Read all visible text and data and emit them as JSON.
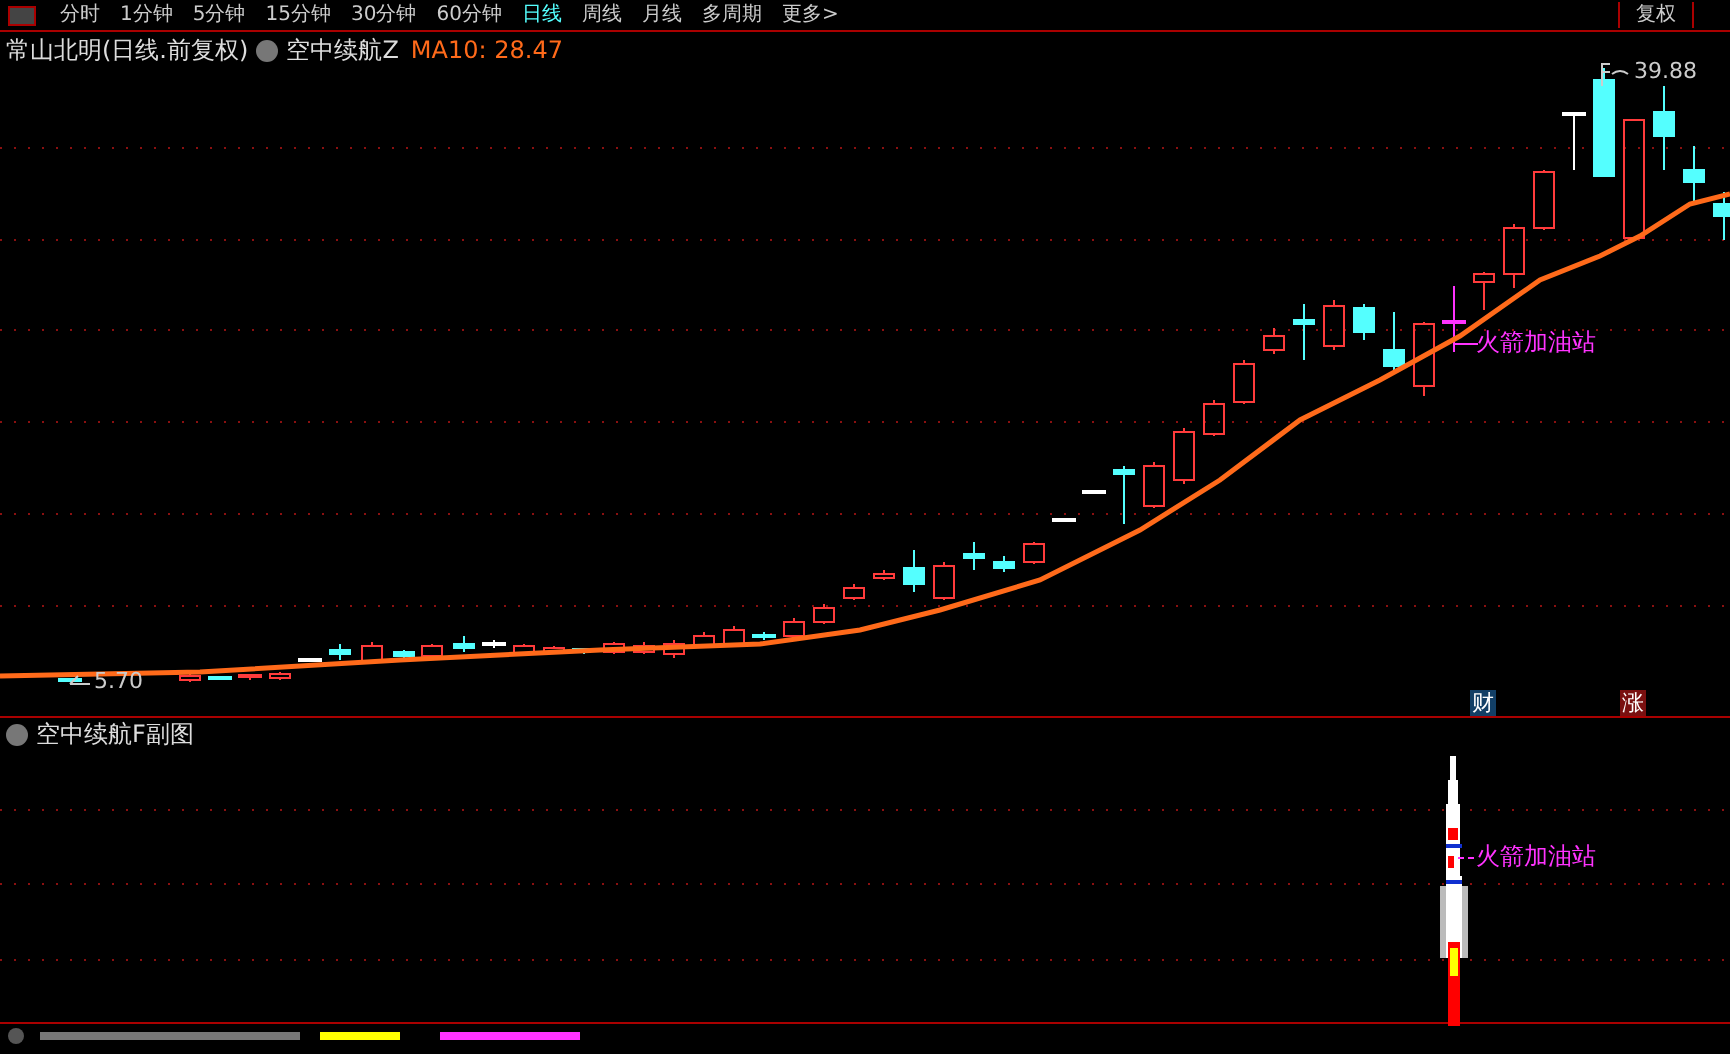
{
  "toolbar": {
    "tabs": [
      {
        "label": "分时",
        "selected": false
      },
      {
        "label": "1分钟",
        "selected": false
      },
      {
        "label": "5分钟",
        "selected": false
      },
      {
        "label": "15分钟",
        "selected": false
      },
      {
        "label": "30分钟",
        "selected": false
      },
      {
        "label": "60分钟",
        "selected": false
      },
      {
        "label": "日线",
        "selected": true
      },
      {
        "label": "周线",
        "selected": false
      },
      {
        "label": "月线",
        "selected": false
      },
      {
        "label": "多周期",
        "selected": false
      },
      {
        "label": "更多>",
        "selected": false
      }
    ],
    "right_button": "复权"
  },
  "main_panel": {
    "title": "常山北明(日线.前复权)",
    "indicator": "空中续航Z",
    "ma_label": "MA10: 28.47",
    "high_label": "39.88",
    "low_label": "5.70",
    "signal_label": "火箭加油站",
    "badges": [
      {
        "text": "财",
        "color": "#123f66"
      },
      {
        "text": "涨",
        "color": "#7a1010"
      }
    ]
  },
  "sub_panel": {
    "title": "空中续航F副图",
    "signal_label": "火箭加油站"
  }
}
